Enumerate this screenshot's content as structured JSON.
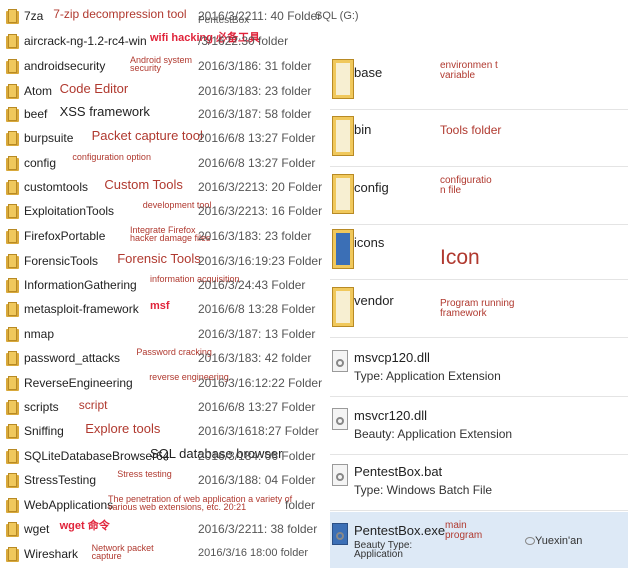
{
  "left_rows": [
    {
      "name": "7za",
      "note": "7-zip decompression tool",
      "note_style": "small",
      "meta": "2016/3/2211: 40 Folder"
    },
    {
      "name": "aircrack-ng-1.2-rc4-win",
      "note": "wifi hacking 必备工具",
      "note_style": "red",
      "meta": "/3/1622:30 folder"
    },
    {
      "name": "androidsecurity",
      "note": "Android system security",
      "note_style": "tiny",
      "meta": "2016/3/186: 31 folder"
    },
    {
      "name": "Atom",
      "note": "Code Editor",
      "note_style": "big",
      "meta": "2016/3/183: 23 folder"
    },
    {
      "name": "beef",
      "note": "XSS framework",
      "note_style": "bigdark",
      "meta": "2016/3/187: 58 folder"
    },
    {
      "name": "burpsuite",
      "note": "Packet capture tool",
      "note_style": "big",
      "meta": "2016/6/8 13:27 Folder"
    },
    {
      "name": "config",
      "note": "configuration option",
      "note_style": "tiny",
      "meta": "2016/6/8 13:27 Folder"
    },
    {
      "name": "customtools",
      "note": "Custom Tools",
      "note_style": "big",
      "meta": "2016/3/2213: 20 Folder"
    },
    {
      "name": "ExploitationTools",
      "note": "development tool",
      "note_style": "tiny",
      "meta": "2016/3/2213: 16 Folder"
    },
    {
      "name": "FirefoxPortable",
      "note": "Integrate Firefox hacker damage files",
      "note_style": "tiny",
      "meta": "2016/3/183: 23 folder"
    },
    {
      "name": "ForensicTools",
      "note": "Forensic Tools",
      "note_style": "big",
      "meta": "2016/3/16:19:23 Folder"
    },
    {
      "name": "InformationGathering",
      "note": "information acquisition",
      "note_style": "tiny",
      "meta": "2016/3/24:43 Folder"
    },
    {
      "name": "metasploit-framework",
      "note": "msf",
      "note_style": "red",
      "meta": "2016/6/8 13:28 Folder"
    },
    {
      "name": "nmap",
      "note": "",
      "note_style": "tiny",
      "meta": "2016/3/187: 13 Folder"
    },
    {
      "name": "password_attacks",
      "note": "Password cracking",
      "note_style": "tiny",
      "meta": "2016/3/183: 42 folder"
    },
    {
      "name": "ReverseEngineering",
      "note": "reverse engineering",
      "note_style": "tiny",
      "meta": "2016/3/16:12:22 Folder"
    },
    {
      "name": "scripts",
      "note": "script",
      "note_style": "small",
      "meta": "2016/6/8 13:27 Folder"
    },
    {
      "name": "Sniffing",
      "note": "Explore tools",
      "note_style": "big",
      "meta": "2016/3/1618:27 Folder"
    },
    {
      "name": "SQLiteDatabaseBrowser64",
      "note": "SQL database browser",
      "note_style": "bigdark",
      "meta": "2016/3/184: 06 Folder"
    },
    {
      "name": "StressTesting",
      "note": "Stress testing",
      "note_style": "tiny",
      "meta": "2016/3/188: 04 Folder"
    },
    {
      "name": "WebApplications",
      "note": "The penetration of web application a variety of various web extensions, etc. 20:21",
      "note_style": "tiny",
      "meta": "folder"
    },
    {
      "name": "wget",
      "note": "wget 命令",
      "note_style": "red",
      "meta": "2016/3/2211: 38 folder"
    },
    {
      "name": "Wireshark",
      "note": "Network packet capture",
      "note_style": "tiny",
      "meta": "2016/3/16 18:00    folder"
    }
  ],
  "header_extra": {
    "pentestbox_label": "PentestBox",
    "sql_label": "SQL (G:)"
  },
  "right_folders": [
    {
      "name": "base",
      "note": "environmen t variable"
    },
    {
      "name": "bin",
      "note": "Tools folder"
    },
    {
      "name": "config",
      "note": "configuratio n file"
    },
    {
      "name": "icons",
      "note": "Icon"
    },
    {
      "name": "vendor",
      "note": "Program running framework"
    }
  ],
  "right_files": [
    {
      "name": "msvcp120.dll",
      "type": "Type: Application Extension"
    },
    {
      "name": "msvcr120.dll",
      "type": "Beauty: Application Extension"
    },
    {
      "name": "PentestBox.bat",
      "type": "Type: Windows Batch File"
    },
    {
      "name": "PentestBox.exe",
      "type": "Beauty Type: Application",
      "note": "main program"
    }
  ],
  "watermark": "Yuexin'an",
  "colors": {
    "note": "#b0392f",
    "note_red": "#e0233a",
    "folder": "#f0c85c",
    "highlight": "#dde9f6"
  }
}
